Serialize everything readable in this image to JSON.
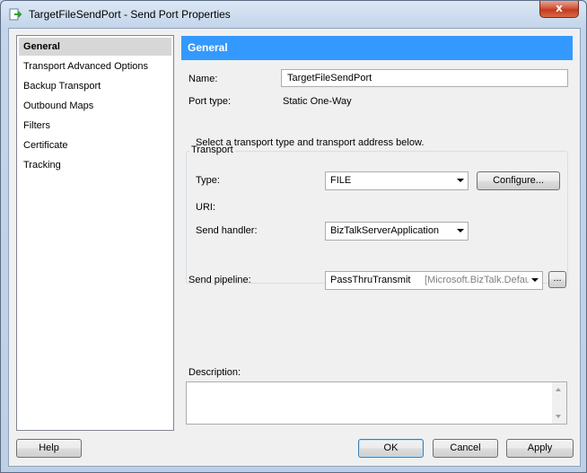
{
  "window": {
    "title": "TargetFileSendPort - Send Port Properties",
    "close_glyph": "x"
  },
  "nav": {
    "items": [
      {
        "label": "General",
        "selected": true
      },
      {
        "label": "Transport Advanced Options"
      },
      {
        "label": "Backup Transport"
      },
      {
        "label": "Outbound Maps"
      },
      {
        "label": "Filters"
      },
      {
        "label": "Certificate"
      },
      {
        "label": "Tracking"
      }
    ]
  },
  "general": {
    "header": "General",
    "name_label": "Name:",
    "name_value": "TargetFileSendPort",
    "port_type_label": "Port type:",
    "port_type_value": "Static One-Way",
    "transport": {
      "group_title": "Transport",
      "instruction": "Select a transport type and transport address below.",
      "type_label": "Type:",
      "type_value": "FILE",
      "configure_label": "Configure...",
      "uri_label": "URI:",
      "send_handler_label": "Send handler:",
      "send_handler_value": "BizTalkServerApplication"
    },
    "send_pipeline_label": "Send pipeline:",
    "send_pipeline_value": "PassThruTransmit",
    "send_pipeline_assembly": "[Microsoft.BizTalk.Default",
    "pipeline_browse_label": "...",
    "description_label": "Description:",
    "description_value": ""
  },
  "footer": {
    "help_label": "Help",
    "ok_label": "OK",
    "cancel_label": "Cancel",
    "apply_label": "Apply"
  }
}
